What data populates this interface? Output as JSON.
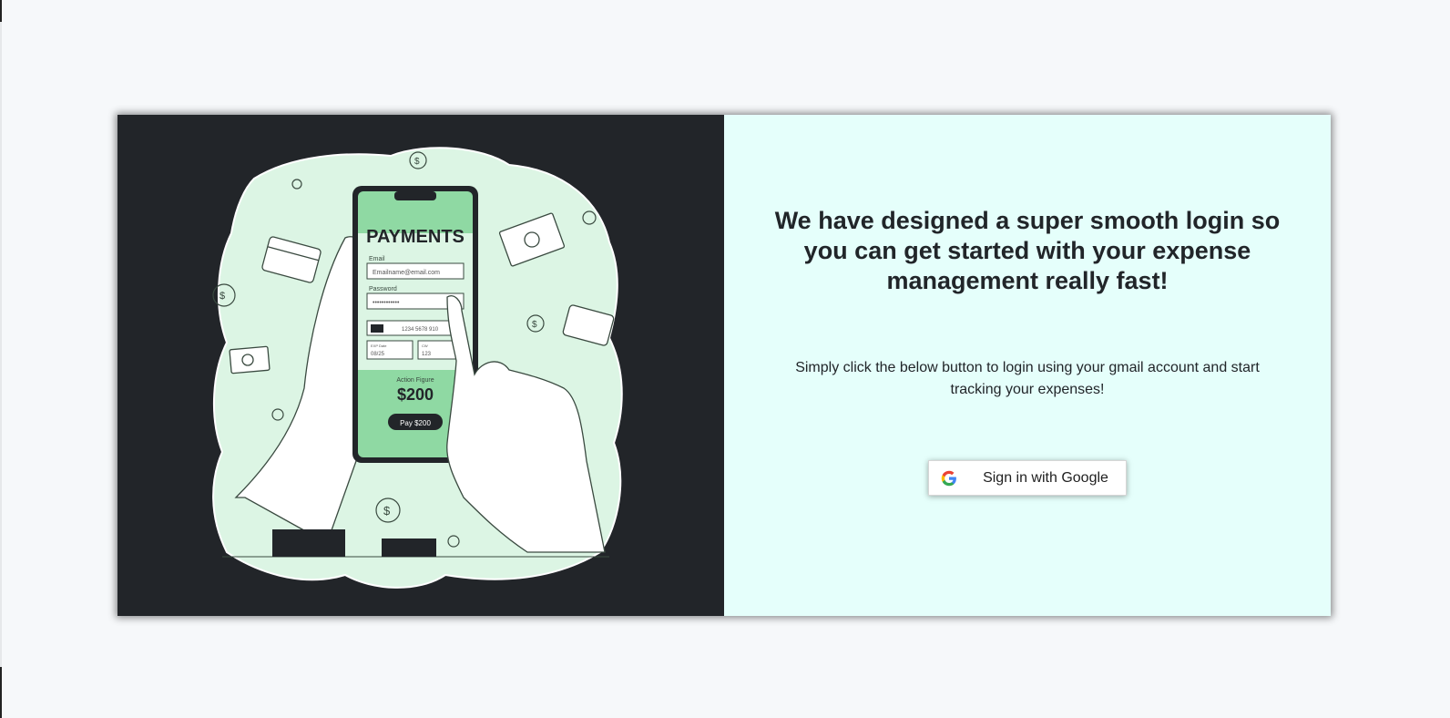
{
  "illustration": {
    "icon": "payment-illustration",
    "phone_title": "PAYMENTS",
    "email_label": "Email",
    "email_placeholder": "Emailname@email.com",
    "password_label": "Password",
    "password_value": "••••••••••••",
    "card_number": "1234 5678 910",
    "exp_label": "EXP Date",
    "exp_value": "08/25",
    "cvv_label": "CW",
    "cvv_value": "123",
    "amount_label": "Action Figure",
    "amount_value": "$200",
    "pay_button": "Pay $200",
    "colors": {
      "background": "#222529",
      "blob": "#dcf5e4",
      "phone_screen": "#8fd9a3"
    }
  },
  "login": {
    "headline": "We have designed a super smooth login so you can get started with your expense management really fast!",
    "subtext": "Simply click the below button to login using your gmail account and start tracking your expenses!",
    "google_button_label": "Sign in with Google",
    "google_icon": "google-g-icon",
    "background_color": "#e5fffb"
  }
}
